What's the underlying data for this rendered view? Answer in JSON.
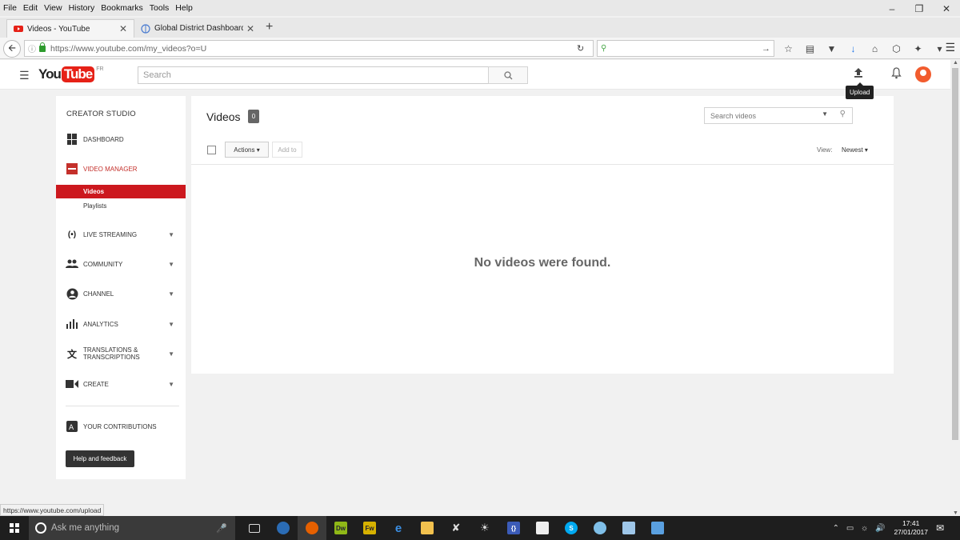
{
  "firefox": {
    "menu": [
      "File",
      "Edit",
      "View",
      "History",
      "Bookmarks",
      "Tools",
      "Help"
    ],
    "tabs": [
      {
        "title": "Videos - YouTube",
        "active": true
      },
      {
        "title": "Global District Dashboard",
        "active": false
      }
    ],
    "url": "https://www.youtube.com/my_videos?o=U",
    "status_url": "https://www.youtube.com/upload"
  },
  "yt": {
    "logo_you": "You",
    "logo_tube": "Tube",
    "country": "FR",
    "search_placeholder": "Search",
    "upload_tooltip": "Upload"
  },
  "sidebar": {
    "title": "CREATOR STUDIO",
    "items": {
      "dashboard": "DASHBOARD",
      "video_manager": "VIDEO MANAGER",
      "videos": "Videos",
      "playlists": "Playlists",
      "live": "LIVE STREAMING",
      "community": "COMMUNITY",
      "channel": "CHANNEL",
      "analytics": "ANALYTICS",
      "translations_1": "TRANSLATIONS &",
      "translations_2": "TRANSCRIPTIONS",
      "create": "CREATE",
      "contributions": "YOUR CONTRIBUTIONS"
    },
    "help_button": "Help and feedback"
  },
  "main": {
    "title": "Videos",
    "count": "0",
    "search_placeholder": "Search videos",
    "actions_label": "Actions",
    "addto_label": "Add to",
    "view_label": "View:",
    "view_value": "Newest",
    "empty_message": "No videos were found."
  },
  "taskbar": {
    "search_text": "Ask me anything",
    "time": "17:41",
    "date": "27/01/2017"
  },
  "colors": {
    "brand_red": "#cc181e",
    "taskbar": "#1e1e1e"
  }
}
